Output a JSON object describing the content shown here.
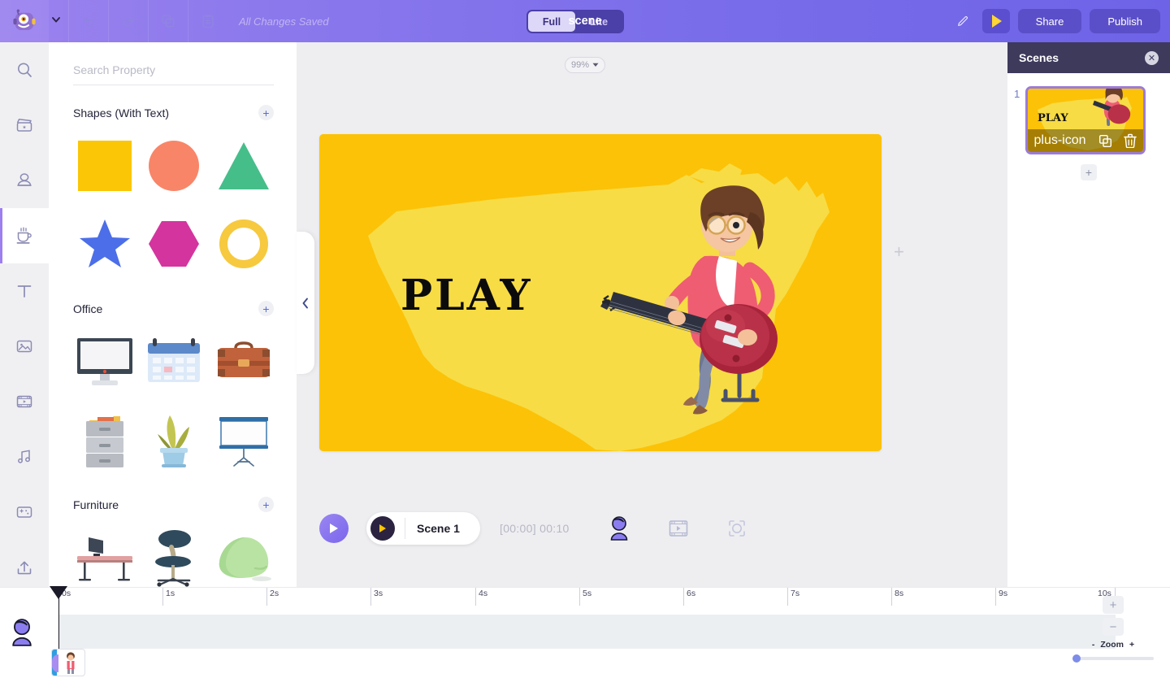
{
  "topbar": {
    "logo_icon": "robot-logo-icon",
    "caret_icon": "chevron-down-icon",
    "undo_icon": "undo-icon",
    "redo_icon": "redo-icon",
    "copy_icon": "duplicate-icon",
    "clipboard_icon": "clipboard-icon",
    "status_text": "All Changes Saved",
    "mode_full": "Full",
    "mode_lite": "Lite",
    "project_title": "scene",
    "pencil_icon": "pencil-icon",
    "preview_icon": "play-icon",
    "share_label": "Share",
    "publish_label": "Publish",
    "accent": "#6e63e7"
  },
  "rail": {
    "items": [
      {
        "icon": "search-icon",
        "active": false
      },
      {
        "icon": "clapperboard-icon",
        "active": false
      },
      {
        "icon": "person-icon",
        "active": false
      },
      {
        "icon": "coffee-cup-icon",
        "active": true
      },
      {
        "icon": "text-icon",
        "active": false
      },
      {
        "icon": "image-icon",
        "active": false
      },
      {
        "icon": "film-icon",
        "active": false
      },
      {
        "icon": "music-icon",
        "active": false
      },
      {
        "icon": "effects-icon",
        "active": false
      },
      {
        "icon": "upload-icon",
        "active": false
      }
    ]
  },
  "panel": {
    "search_placeholder": "Search Property",
    "search_value": "",
    "collapse_icon": "chevron-left-icon",
    "sections": [
      {
        "title": "Shapes (With Text)",
        "add_label": "+",
        "items": [
          {
            "name": "shape-square",
            "color": "#fbc606"
          },
          {
            "name": "shape-circle",
            "color": "#f98568"
          },
          {
            "name": "shape-triangle",
            "color": "#46be8a"
          },
          {
            "name": "shape-star",
            "color": "#4c6ee8"
          },
          {
            "name": "shape-hexagon",
            "color": "#d4349e"
          },
          {
            "name": "shape-ring",
            "color": "#f6c93f"
          }
        ]
      },
      {
        "title": "Office",
        "add_label": "+",
        "items": [
          {
            "name": "monitor"
          },
          {
            "name": "calendar"
          },
          {
            "name": "briefcase"
          },
          {
            "name": "file-cabinet"
          },
          {
            "name": "potted-plant"
          },
          {
            "name": "projector-screen"
          }
        ]
      },
      {
        "title": "Furniture",
        "add_label": "+",
        "items": [
          {
            "name": "desk"
          },
          {
            "name": "office-chair"
          },
          {
            "name": "bean-bag"
          }
        ]
      }
    ]
  },
  "stage": {
    "zoom_level": "99%",
    "zoom_caret_icon": "chevron-down-icon",
    "add_marker": "+",
    "canvas": {
      "background_color": "#fcc207",
      "map_color": "#f7db44",
      "text": "PLAY",
      "character": "woman-playing-electric-guitar"
    }
  },
  "player": {
    "play_icon": "play-icon",
    "scene_chip_play_icon": "play-icon",
    "scene_label": "Scene 1",
    "time_display": "[00:00] 00:10",
    "character_icon": "character-icon",
    "slide_icon": "slide-icon",
    "focus_icon": "focus-icon"
  },
  "scenes": {
    "title": "Scenes",
    "close_icon": "close-icon",
    "list": [
      {
        "number": "1",
        "text": "PLAY",
        "add_icon": "plus-icon",
        "duplicate_icon": "duplicate-icon",
        "delete_icon": "trash-icon"
      }
    ],
    "add_scene_label": "+"
  },
  "timeline": {
    "ticks": [
      "0s",
      "1s",
      "2s",
      "3s",
      "4s",
      "5s",
      "6s",
      "7s",
      "8s",
      "9s",
      "10s"
    ],
    "track_avatar_icon": "character-icon",
    "clip_thumbnail": "character-thumbnail",
    "zoom_in_label": "+",
    "zoom_out_label": "−",
    "zoom_minus": "-",
    "zoom_label": "Zoom",
    "zoom_plus": "+"
  }
}
